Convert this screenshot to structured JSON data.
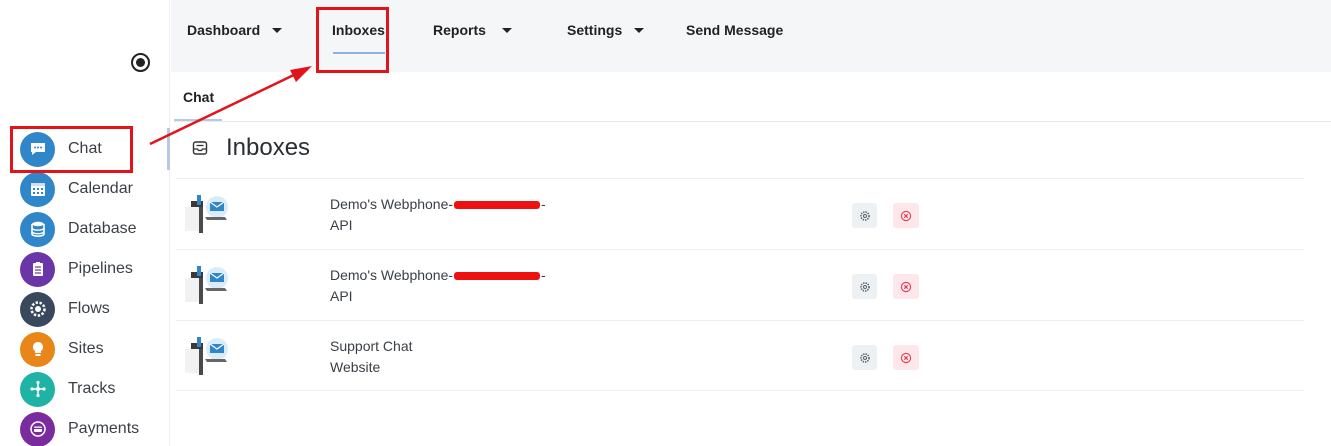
{
  "sidebar": {
    "items": [
      {
        "label": "Chat",
        "icon": "chat-icon",
        "color": "#2f86c9"
      },
      {
        "label": "Calendar",
        "icon": "calendar-icon",
        "color": "#2f86c9"
      },
      {
        "label": "Database",
        "icon": "database-icon",
        "color": "#2f86c9"
      },
      {
        "label": "Pipelines",
        "icon": "clipboard-icon",
        "color": "#6a35a6"
      },
      {
        "label": "Flows",
        "icon": "gear-icon",
        "color": "#39485d"
      },
      {
        "label": "Sites",
        "icon": "bulb-icon",
        "color": "#e9861a"
      },
      {
        "label": "Tracks",
        "icon": "network-icon",
        "color": "#1fb3a5"
      },
      {
        "label": "Payments",
        "icon": "card-icon",
        "color": "#7a2c9e"
      }
    ]
  },
  "topnav": {
    "dashboard": "Dashboard",
    "inboxes": "Inboxes",
    "reports": "Reports",
    "settings": "Settings",
    "send_message": "Send Message"
  },
  "subtabs": {
    "chat": "Chat"
  },
  "page": {
    "title": "Inboxes"
  },
  "inboxes": [
    {
      "name_prefix": "Demo's Webphone-",
      "name_suffix": "-",
      "type": "API"
    },
    {
      "name_prefix": "Demo's Webphone-",
      "name_suffix": "-",
      "type": "API"
    },
    {
      "name_prefix": "Support Chat",
      "name_suffix": "",
      "type": "Website"
    }
  ],
  "colors": {
    "annotation": "#e3131b",
    "active_underline": "#8ab4df"
  }
}
